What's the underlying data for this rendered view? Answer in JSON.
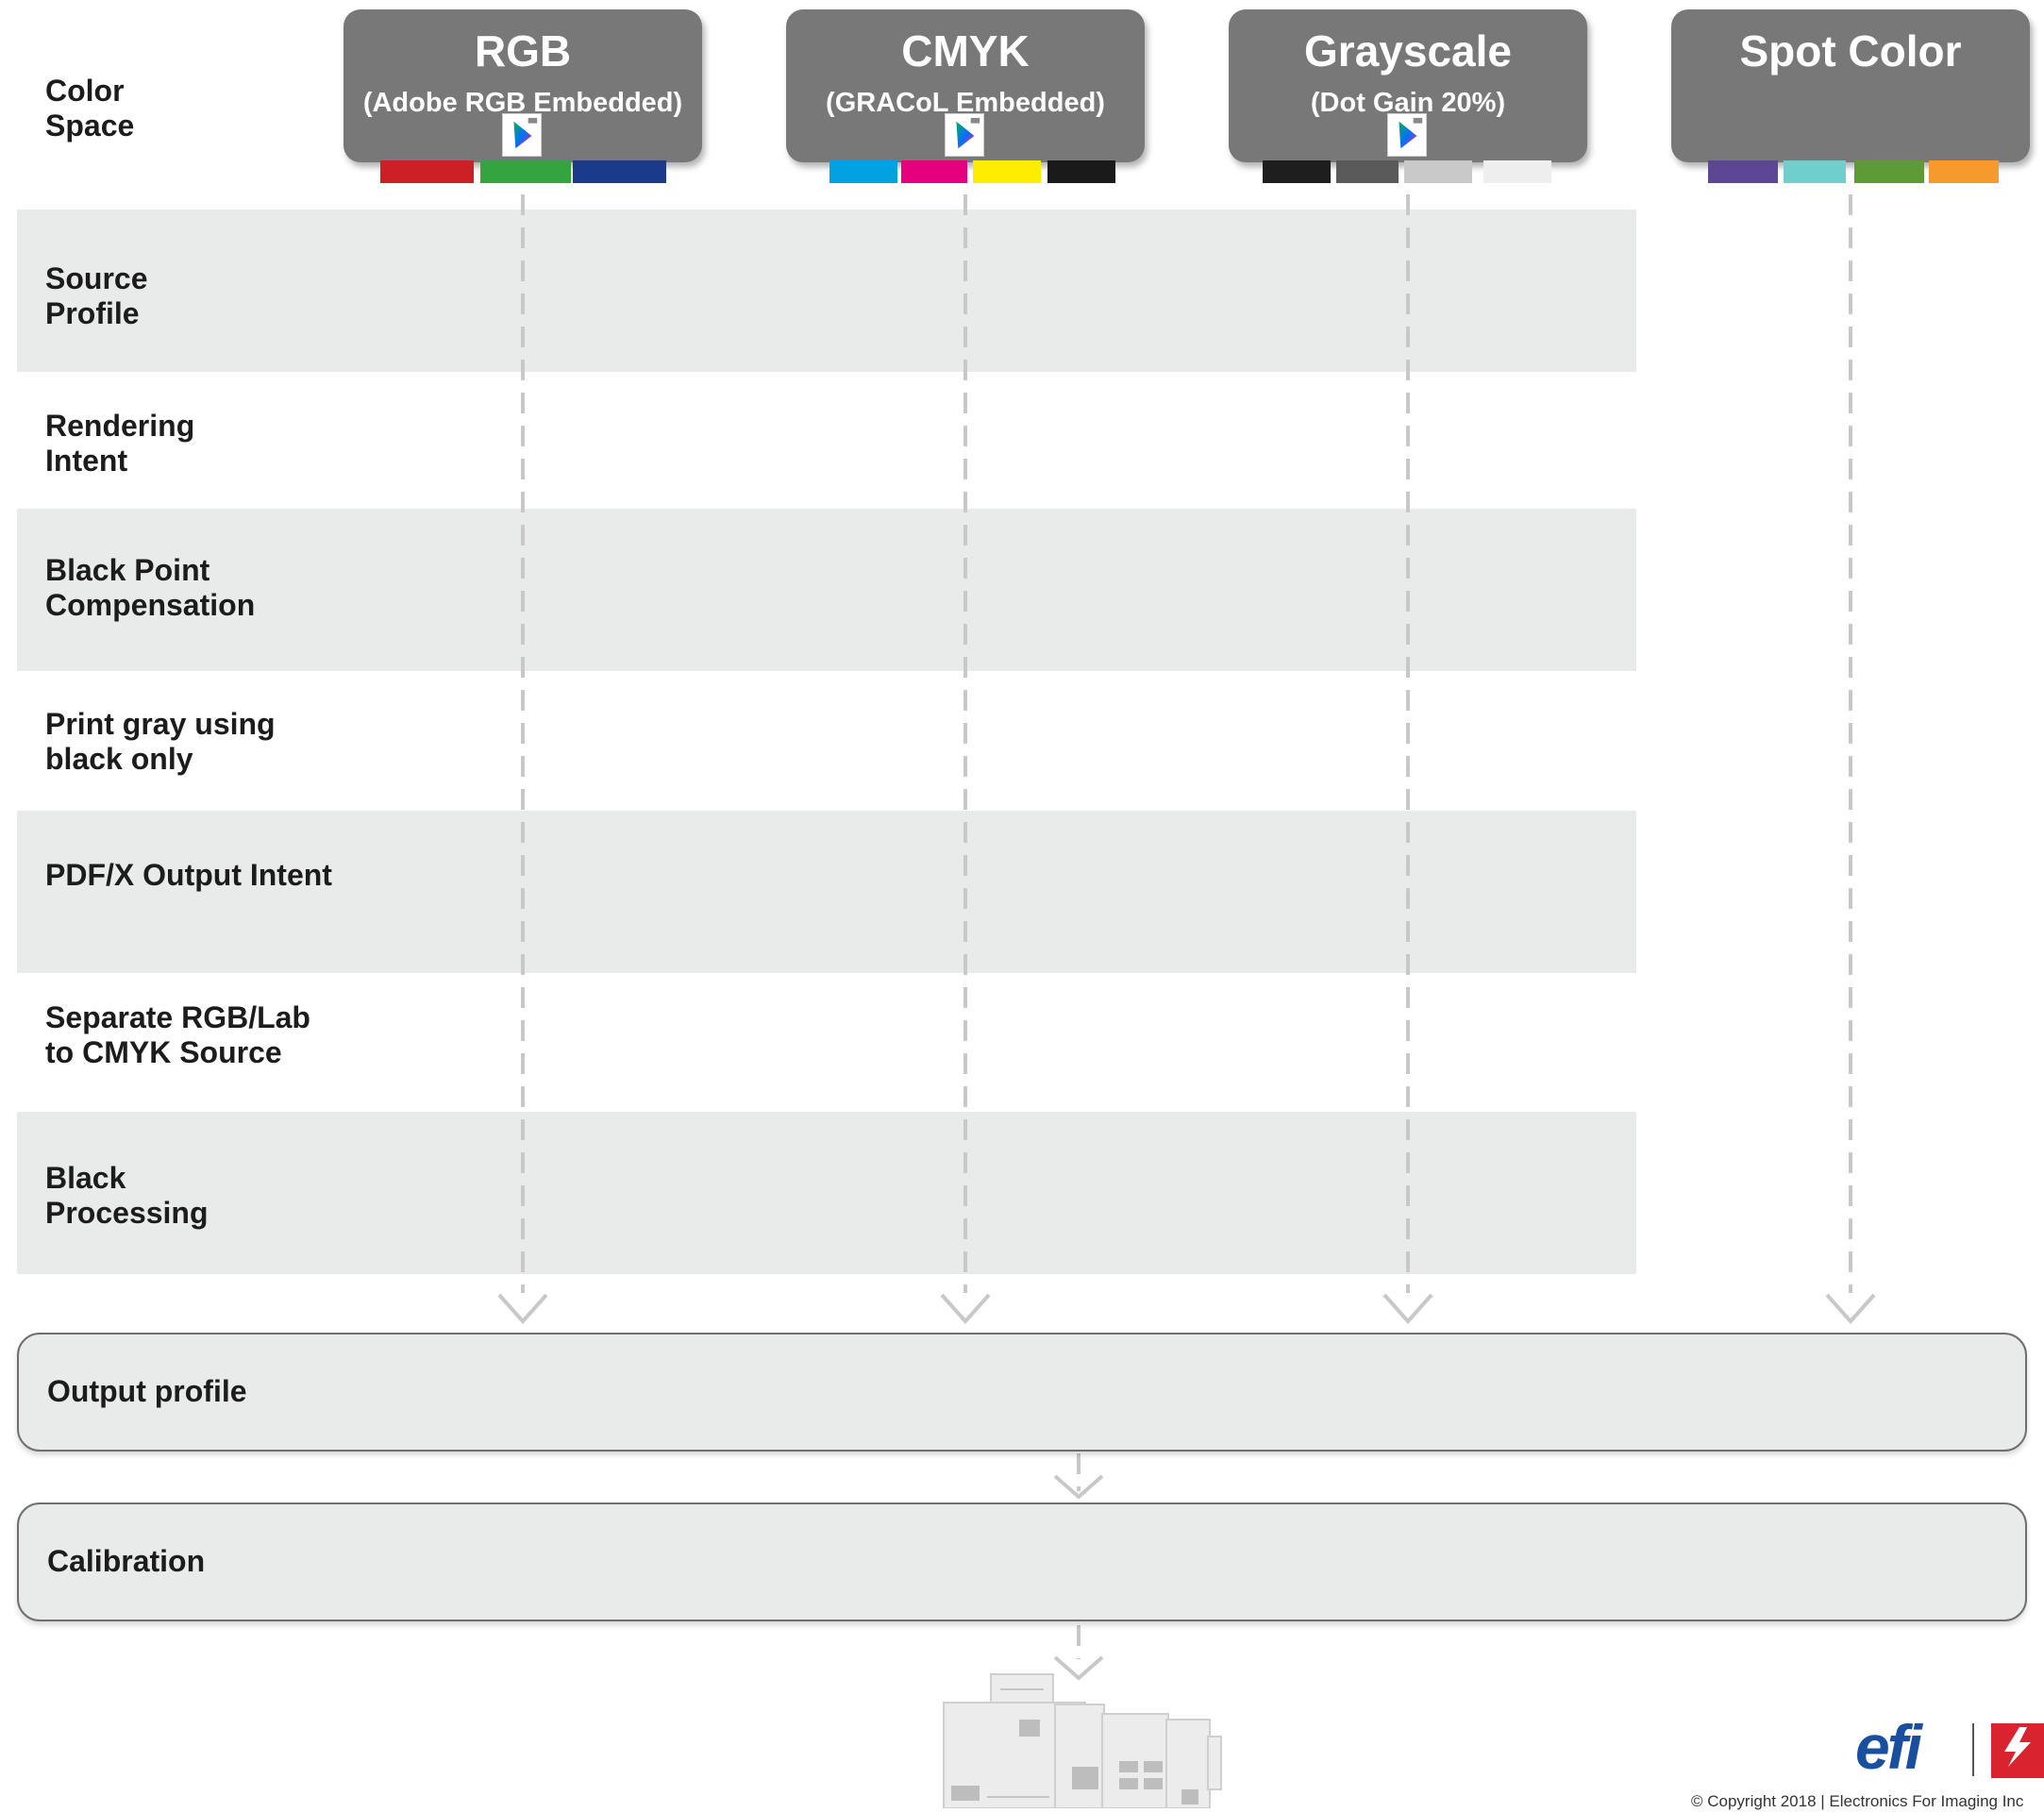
{
  "rows": [
    {
      "label": "Color\nSpace"
    },
    {
      "label": "Source\nProfile"
    },
    {
      "label": "Rendering\nIntent"
    },
    {
      "label": "Black Point\nCompensation"
    },
    {
      "label": "Print gray using\nblack only"
    },
    {
      "label": "PDF/X Output Intent"
    },
    {
      "label": "Separate RGB/Lab\nto CMYK Source"
    },
    {
      "label": "Black\nProcessing"
    }
  ],
  "columns": [
    {
      "title": "RGB",
      "subtitle": "(Adobe RGB Embedded)",
      "has_profile_icon": true,
      "swatches": [
        "#cc2027",
        "#34a441",
        "#1b3a8c"
      ]
    },
    {
      "title": "CMYK",
      "subtitle": "(GRACoL Embedded)",
      "has_profile_icon": true,
      "swatches": [
        "#00a3e0",
        "#e6007e",
        "#ffed00",
        "#1a1a1a"
      ]
    },
    {
      "title": "Grayscale",
      "subtitle": "(Dot Gain 20%)",
      "has_profile_icon": true,
      "swatches": [
        "#1e1e1e",
        "#5a5a5a",
        "#c9c9c9",
        "#eeeeee"
      ]
    },
    {
      "title": "Spot Color",
      "subtitle": "",
      "has_profile_icon": false,
      "swatches": [
        "#5b4796",
        "#6fcfcc",
        "#5e9b34",
        "#f79a2e"
      ]
    }
  ],
  "stages": {
    "output": "Output profile",
    "calibration": "Calibration"
  },
  "branding": {
    "efi": "efi",
    "fiery": "fiery",
    "copyright": "© Copyright 2018 | Electronics For Imaging Inc"
  },
  "colors": {
    "card_bg": "#787878",
    "row_band": "#e9eaea",
    "flow_line": "#c8c8c8",
    "efi_blue": "#1a4fa0",
    "fiery_red": "#d9232e"
  }
}
